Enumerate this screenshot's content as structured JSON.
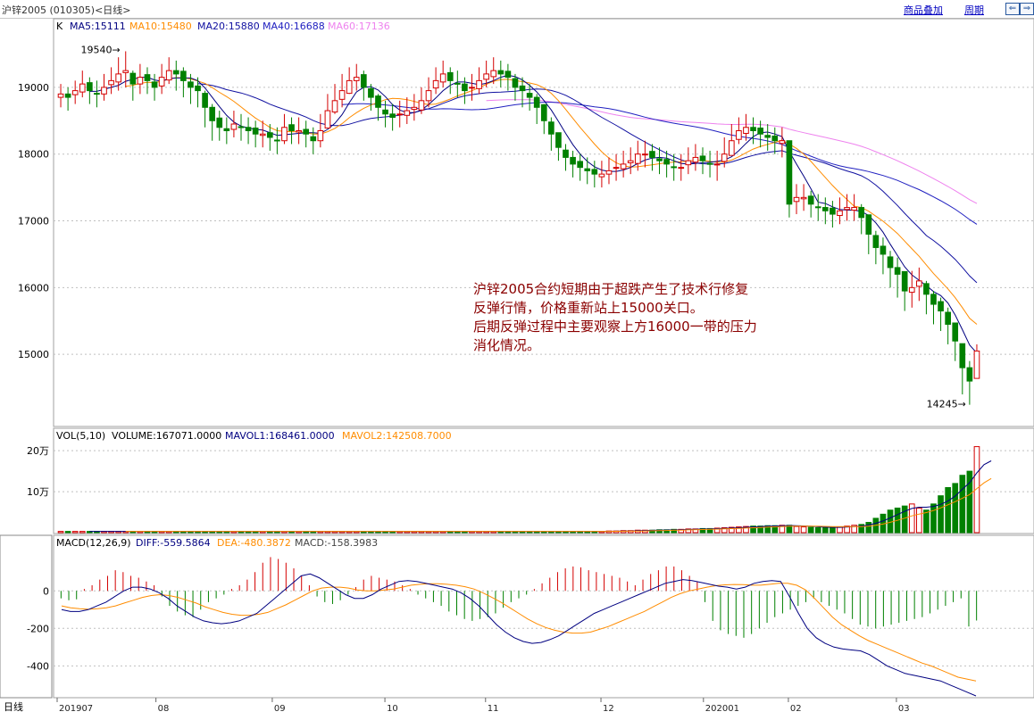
{
  "window": {
    "title": "沪锌2005 (010305)<日线>",
    "btn_overlay": "商品叠加",
    "btn_period": "周期",
    "nav_left": "⇐",
    "nav_right": "⇒"
  },
  "ma_legend": {
    "k": "K",
    "ma5": "MA5:15111",
    "ma10": "MA10:15480",
    "ma20": "MA20:15880",
    "ma40": "MA40:16688",
    "ma60": "MA60:17136"
  },
  "vol_legend": {
    "name": "VOL(5,10)",
    "volume": "VOLUME:167071.0000",
    "mavol1": "MAVOL1:168461.0000",
    "mavol2": "MAVOL2:142508.7000"
  },
  "macd_legend": {
    "name": "MACD(12,26,9)",
    "diff": "DIFF:-559.5864",
    "dea": "DEA:-480.3872",
    "macd": "MACD:-158.3983"
  },
  "annotation": {
    "line1": "沪锌2005合约短期由于超跌产生了技术行修复",
    "line2": "反弹行情，价格重新站上15000关口。",
    "line3": "后期反弹过程中主要观察上方16000一带的压力",
    "line4": "消化情况。"
  },
  "period_label": "日线",
  "x_labels": [
    "201907",
    "08",
    "09",
    "10",
    "11",
    "12",
    "202001",
    "02",
    "03"
  ],
  "colors": {
    "up": "#d40000",
    "down": "#008000",
    "ma5": "#000080",
    "ma10": "#ff8c00",
    "ma20": "#1010a0",
    "ma40": "#2020c0",
    "ma60": "#ee82ee",
    "grid": "#c0c0c0"
  },
  "chart_data": [
    {
      "type": "candlestick",
      "yticks": [
        15000,
        16000,
        17000,
        18000,
        19000
      ],
      "ylim": [
        14000,
        19800
      ],
      "high_label": "19540",
      "low_label": "14245",
      "closes": [
        18900,
        18850,
        18950,
        19050,
        18950,
        18900,
        19000,
        19100,
        19200,
        19250,
        19050,
        19150,
        19100,
        19000,
        19150,
        19250,
        19200,
        19100,
        19000,
        18950,
        18700,
        18500,
        18400,
        18350,
        18450,
        18400,
        18350,
        18300,
        18300,
        18250,
        18200,
        18400,
        18350,
        18350,
        18300,
        18200,
        18350,
        18650,
        18800,
        18950,
        19100,
        19150,
        19000,
        18850,
        18700,
        18600,
        18550,
        18600,
        18650,
        18700,
        18800,
        18950,
        19100,
        19200,
        19100,
        19050,
        18950,
        19000,
        19100,
        19200,
        19250,
        19200,
        19150,
        19000,
        18950,
        18850,
        18700,
        18500,
        18300,
        18100,
        17950,
        17850,
        17800,
        17750,
        17700,
        17700,
        17750,
        17800,
        17850,
        17900,
        18000,
        18000,
        17950,
        17900,
        17850,
        17800,
        17800,
        17900,
        17950,
        17900,
        17850,
        17850,
        18000,
        18200,
        18350,
        18400,
        18350,
        18300,
        18250,
        18200,
        18200,
        17250,
        17350,
        17350,
        17250,
        17200,
        17150,
        17100,
        17150,
        17200,
        17200,
        17050,
        16800,
        16600,
        16500,
        16300,
        16200,
        15950,
        16000,
        16100,
        15900,
        15750,
        15650,
        15450,
        15200,
        14800,
        14600,
        15050
      ],
      "price_lows": [
        18700,
        18650,
        18750,
        18850,
        18750,
        18700,
        18800,
        18900,
        18950,
        19000,
        18800,
        18900,
        18900,
        18800,
        18900,
        19050,
        18950,
        18850,
        18750,
        18700,
        18400,
        18200,
        18200,
        18150,
        18250,
        18200,
        18150,
        18100,
        18100,
        18050,
        18000,
        18150,
        18150,
        18150,
        18100,
        18000,
        18100,
        18400,
        18600,
        18700,
        18900,
        18950,
        18800,
        18650,
        18500,
        18400,
        18350,
        18400,
        18450,
        18500,
        18600,
        18700,
        18900,
        19000,
        18900,
        18850,
        18750,
        18800,
        18900,
        19000,
        19050,
        19000,
        18950,
        18800,
        18700,
        18650,
        18450,
        18300,
        18050,
        17900,
        17750,
        17650,
        17600,
        17550,
        17500,
        17500,
        17550,
        17600,
        17650,
        17700,
        17750,
        17800,
        17750,
        17700,
        17650,
        17600,
        17600,
        17700,
        17750,
        17700,
        17650,
        17600,
        17800,
        18000,
        18150,
        18200,
        18150,
        18100,
        18050,
        18000,
        17950,
        17050,
        17100,
        17150,
        17050,
        17000,
        16950,
        16900,
        16950,
        17000,
        17000,
        16800,
        16500,
        16350,
        16200,
        16000,
        15850,
        15650,
        15700,
        15800,
        15600,
        15450,
        15350,
        15150,
        14900,
        14400,
        14245,
        14700
      ],
      "price_highs": [
        19050,
        19000,
        19100,
        19250,
        19150,
        19100,
        19200,
        19300,
        19450,
        19540,
        19250,
        19350,
        19300,
        19200,
        19350,
        19450,
        19400,
        19300,
        19200,
        19150,
        18950,
        18750,
        18650,
        18550,
        18650,
        18600,
        18550,
        18500,
        18500,
        18450,
        18400,
        18600,
        18550,
        18550,
        18500,
        18400,
        18600,
        18900,
        19050,
        19200,
        19300,
        19350,
        19250,
        19050,
        18900,
        18800,
        18750,
        18800,
        18850,
        18900,
        19000,
        19150,
        19300,
        19400,
        19300,
        19250,
        19150,
        19200,
        19300,
        19400,
        19450,
        19400,
        19350,
        19200,
        19150,
        19050,
        18900,
        18750,
        18550,
        18300,
        18150,
        18050,
        18000,
        17950,
        17900,
        17900,
        17950,
        18000,
        18050,
        18100,
        18200,
        18200,
        18150,
        18100,
        18050,
        18000,
        18000,
        18100,
        18150,
        18100,
        18050,
        18050,
        18250,
        18450,
        18550,
        18600,
        18550,
        18500,
        18450,
        18400,
        18400,
        17500,
        17550,
        17550,
        17450,
        17400,
        17350,
        17300,
        17350,
        17400,
        17400,
        17250,
        17050,
        16850,
        16750,
        16550,
        16450,
        16200,
        16250,
        16300,
        16100,
        15950,
        15850,
        15700,
        15450,
        15100,
        14900,
        15150
      ]
    },
    {
      "type": "bar",
      "yticks_labels": [
        "10万",
        "20万"
      ],
      "yticks": [
        100000,
        200000
      ],
      "ylim": [
        0,
        220000
      ],
      "volumes": [
        3000,
        3000,
        3000,
        3000,
        3000,
        3000,
        3000,
        3000,
        3000,
        3000,
        3000,
        3000,
        3000,
        3000,
        3000,
        3000,
        3000,
        3000,
        3000,
        3000,
        3000,
        3000,
        3000,
        3000,
        3000,
        3000,
        3000,
        3000,
        3000,
        3000,
        3000,
        3000,
        3000,
        3000,
        3000,
        3000,
        3000,
        3000,
        3000,
        3000,
        3000,
        3000,
        3000,
        3000,
        3000,
        3000,
        3000,
        3000,
        3000,
        3000,
        3000,
        3000,
        3000,
        3000,
        3000,
        3000,
        3000,
        3000,
        3000,
        3000,
        3000,
        3000,
        3000,
        3000,
        3000,
        3000,
        3000,
        3000,
        3000,
        3000,
        3000,
        3000,
        3000,
        3000,
        3000,
        3000,
        4000,
        4000,
        5000,
        5000,
        6000,
        6000,
        6000,
        7000,
        7000,
        8000,
        8000,
        9000,
        9000,
        10000,
        10000,
        11000,
        12000,
        13000,
        14000,
        15000,
        16000,
        16000,
        17000,
        17000,
        18000,
        18000,
        15000,
        14000,
        13000,
        12000,
        12000,
        13000,
        14000,
        16000,
        18000,
        20000,
        25000,
        35000,
        45000,
        55000,
        60000,
        65000,
        70000,
        60000,
        55000,
        70000,
        90000,
        110000,
        120000,
        140000,
        150000,
        210000,
        210000,
        167071
      ]
    },
    {
      "type": "line",
      "yticks": [
        -400,
        -200,
        0
      ],
      "ylim": [
        -560,
        220
      ],
      "macd": [
        -40,
        -50,
        -45,
        10,
        30,
        60,
        80,
        110,
        100,
        80,
        70,
        50,
        30,
        -30,
        -80,
        -110,
        -130,
        -140,
        -100,
        -60,
        -40,
        -20,
        10,
        30,
        60,
        100,
        150,
        180,
        170,
        150,
        120,
        80,
        30,
        -30,
        -60,
        -70,
        -50,
        -20,
        20,
        60,
        80,
        70,
        60,
        50,
        30,
        10,
        -20,
        -40,
        -60,
        -80,
        -110,
        -130,
        -150,
        -160,
        -150,
        -140,
        -120,
        -90,
        -60,
        -40,
        -20,
        10,
        40,
        70,
        100,
        120,
        130,
        125,
        110,
        100,
        90,
        80,
        70,
        50,
        30,
        60,
        90,
        110,
        130,
        130,
        110,
        80,
        50,
        -60,
        -160,
        -210,
        -230,
        -240,
        -250,
        -230,
        -200,
        -170,
        -140,
        -120,
        -100,
        -80,
        -60,
        -40,
        -60,
        -80,
        -100,
        -120,
        -150,
        -180,
        -190,
        -200,
        -190,
        -180,
        -170,
        -160,
        -150,
        -140,
        -120,
        -100,
        -80,
        -60,
        -40,
        -190,
        -158
      ],
      "diff": [
        -100,
        -110,
        -110,
        -100,
        -80,
        -60,
        -30,
        0,
        20,
        20,
        10,
        -10,
        -40,
        -80,
        -110,
        -140,
        -160,
        -170,
        -175,
        -170,
        -160,
        -140,
        -120,
        -80,
        -40,
        0,
        40,
        80,
        90,
        70,
        40,
        10,
        -20,
        -40,
        -40,
        -20,
        10,
        30,
        50,
        55,
        50,
        40,
        30,
        20,
        10,
        -10,
        -40,
        -80,
        -130,
        -180,
        -220,
        -250,
        -270,
        -280,
        -275,
        -260,
        -240,
        -210,
        -180,
        -150,
        -120,
        -100,
        -80,
        -60,
        -40,
        -20,
        0,
        20,
        40,
        50,
        60,
        55,
        45,
        35,
        25,
        20,
        10,
        20,
        40,
        50,
        55,
        50,
        -30,
        -120,
        -200,
        -250,
        -280,
        -300,
        -310,
        -315,
        -320,
        -340,
        -370,
        -400,
        -420,
        -440,
        -450,
        -460,
        -470,
        -480,
        -500,
        -520,
        -540,
        -560
      ],
      "dea": [
        -80,
        -90,
        -95,
        -98,
        -95,
        -90,
        -80,
        -65,
        -50,
        -35,
        -25,
        -20,
        -25,
        -35,
        -50,
        -65,
        -85,
        -100,
        -115,
        -125,
        -130,
        -130,
        -125,
        -115,
        -95,
        -75,
        -50,
        -25,
        0,
        15,
        20,
        20,
        15,
        5,
        0,
        0,
        5,
        10,
        20,
        30,
        35,
        38,
        38,
        35,
        30,
        22,
        10,
        -10,
        -35,
        -60,
        -90,
        -120,
        -150,
        -175,
        -195,
        -210,
        -220,
        -225,
        -225,
        -220,
        -205,
        -190,
        -170,
        -150,
        -130,
        -110,
        -85,
        -60,
        -35,
        -15,
        0,
        10,
        20,
        28,
        32,
        34,
        33,
        30,
        30,
        35,
        40,
        40,
        30,
        5,
        -40,
        -90,
        -140,
        -180,
        -210,
        -240,
        -265,
        -285,
        -305,
        -325,
        -345,
        -365,
        -385,
        -400,
        -420,
        -440,
        -460,
        -470,
        -480
      ]
    }
  ]
}
